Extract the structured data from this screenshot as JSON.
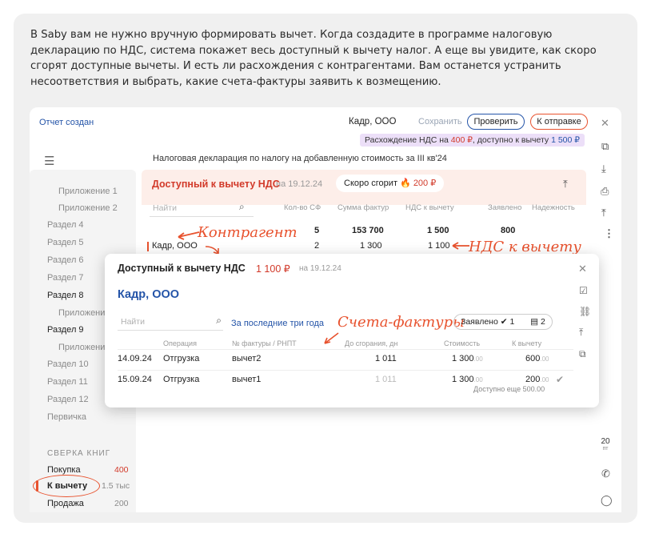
{
  "intro_text": "В Saby вам не нужно вручную формировать вычет. Когда создадите в программе налоговую декларацию по НДС, система покажет весь доступный к вычету налог. А еще вы увидите, как скоро сгорят доступные вычеты. И есть ли расхождения с контрагентами. Вам останется устранить несоответствия и выбрать, какие счета-фактуры заявить к возмещению.",
  "topbar": {
    "status": "Отчет создан",
    "org": "Кадр, ООО",
    "save": "Сохранить",
    "check": "Проверить",
    "send": "К отправке"
  },
  "discrepancy": {
    "prefix": "Расхождение НДС на ",
    "amount": "400 ₽",
    "middle": ", доступно к вычету ",
    "available": "1 500 ₽"
  },
  "declaration_title": "Налоговая декларация по налогу на добавленную стоимость за III кв'24",
  "nav": {
    "items": [
      {
        "label": "Приложение 1",
        "style": "sub"
      },
      {
        "label": "Приложение 2",
        "style": "sub"
      },
      {
        "label": "Раздел 4",
        "style": "grey"
      },
      {
        "label": "Раздел 5",
        "style": "grey"
      },
      {
        "label": "Раздел 6",
        "style": "grey"
      },
      {
        "label": "Раздел 7",
        "style": "grey"
      },
      {
        "label": "Раздел 8",
        "style": "dark"
      },
      {
        "label": "Приложени",
        "style": "sub"
      },
      {
        "label": "Раздел 9",
        "style": "dark"
      },
      {
        "label": "Приложени",
        "style": "sub"
      },
      {
        "label": "Раздел 10",
        "style": "grey"
      },
      {
        "label": "Раздел 11",
        "style": "grey"
      },
      {
        "label": "Раздел 12",
        "style": "grey"
      },
      {
        "label": "Первичка",
        "style": "grey"
      }
    ],
    "books_header": "СВЕРКА КНИГ",
    "books": [
      {
        "label": "Покупка",
        "count": "400"
      },
      {
        "label": "К вычету",
        "count": "1.5 тыс"
      },
      {
        "label": "Продажа",
        "count": "200"
      }
    ]
  },
  "panel": {
    "title": "Доступный к вычету НДС",
    "date": "на 19.12.24",
    "soon_label": "Скоро сгорит ",
    "soon_amount": "200 ₽",
    "search_placeholder": "Найти",
    "columns": [
      "Кол-во СФ",
      "Сумма фактур",
      "НДС к вычету",
      "Заявлено",
      "Надежность"
    ],
    "totals": {
      "count": "5",
      "sum": "153 700",
      "vat": "1 500",
      "declared": "800"
    },
    "row": {
      "name": "Кадр, ООО",
      "count": "2",
      "sum": "1 300",
      "vat": "1 100"
    }
  },
  "annotations": {
    "counterparty": "Контрагент",
    "vat_deduction": "НДС к вычету",
    "invoices": "Счета-фактуры"
  },
  "overlay": {
    "title": "Доступный к вычету НДС",
    "sum": "1 100 ₽",
    "date": "на 19.12.24",
    "org": "Кадр, ООО",
    "search_placeholder": "Найти",
    "period_link": "За последние три года",
    "declared_chip": "Заявлено ✔ 1",
    "docs_chip": "2",
    "columns": [
      "Операция",
      "№ фактуры / РНПТ",
      "До сгорания, дн",
      "Стоимость",
      "К вычету"
    ],
    "rows": [
      {
        "date": "14.09.24",
        "operation": "Отгрузка",
        "invoice": "вычет2",
        "days": "1 011",
        "cost": "1 300",
        "cost_dec": ".00",
        "deduct": "600",
        "deduct_dec": ".00",
        "note": ""
      },
      {
        "date": "15.09.24",
        "operation": "Отгрузка",
        "invoice": "вычет1",
        "days": "1 011",
        "cost": "1 300",
        "cost_dec": ".00",
        "deduct": "200",
        "deduct_dec": ".00",
        "note": "Доступно еще 500.00"
      }
    ]
  },
  "rail": {
    "date_day": "20",
    "date_dow": "пт"
  },
  "colors": {
    "accent_blue": "#2454a8",
    "accent_red": "#d23a2a",
    "annotation_orange": "#e8522e",
    "discrepancy_bg": "#ecdff8"
  }
}
